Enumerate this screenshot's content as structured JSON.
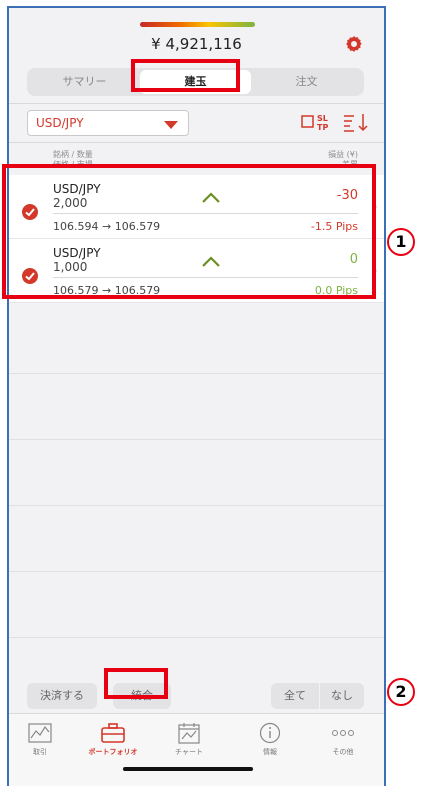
{
  "header": {
    "balance": "¥ 4,921,116"
  },
  "segments": [
    {
      "label": "サマリー",
      "active": false
    },
    {
      "label": "建玉",
      "active": true
    },
    {
      "label": "注文",
      "active": false
    }
  ],
  "toolbar": {
    "pair": "USD/JPY"
  },
  "columns": {
    "left_line1": "銘柄 / 数量",
    "left_line2": "価格 / 市場",
    "right_line1": "損益 (¥)",
    "right_line2": "差異"
  },
  "positions": [
    {
      "symbol": "USD/JPY",
      "qty": "2,000",
      "pl": "-30",
      "rates": "106.594 → 106.579",
      "pips": "-1.5 Pips",
      "pl_color": "#d3382a"
    },
    {
      "symbol": "USD/JPY",
      "qty": "1,000",
      "pl": "0",
      "rates": "106.579 → 106.579",
      "pips": "0.0 Pips",
      "pl_color": "#7cb342"
    }
  ],
  "actions": {
    "settle": "決済する",
    "merge": "統合",
    "all": "全て",
    "none": "なし"
  },
  "tabs": [
    {
      "label": "取引",
      "icon": "trade-chart-icon"
    },
    {
      "label": "ポートフォリオ",
      "icon": "briefcase-icon"
    },
    {
      "label": "チャート",
      "icon": "calendar-chart-icon"
    },
    {
      "label": "情報",
      "icon": "info-icon"
    },
    {
      "label": "その他",
      "icon": "more-dots-icon"
    }
  ],
  "callouts": [
    "1",
    "2"
  ],
  "colors": {
    "accent": "#d3382a",
    "highlight": "#e60012",
    "positive": "#7cb342"
  }
}
